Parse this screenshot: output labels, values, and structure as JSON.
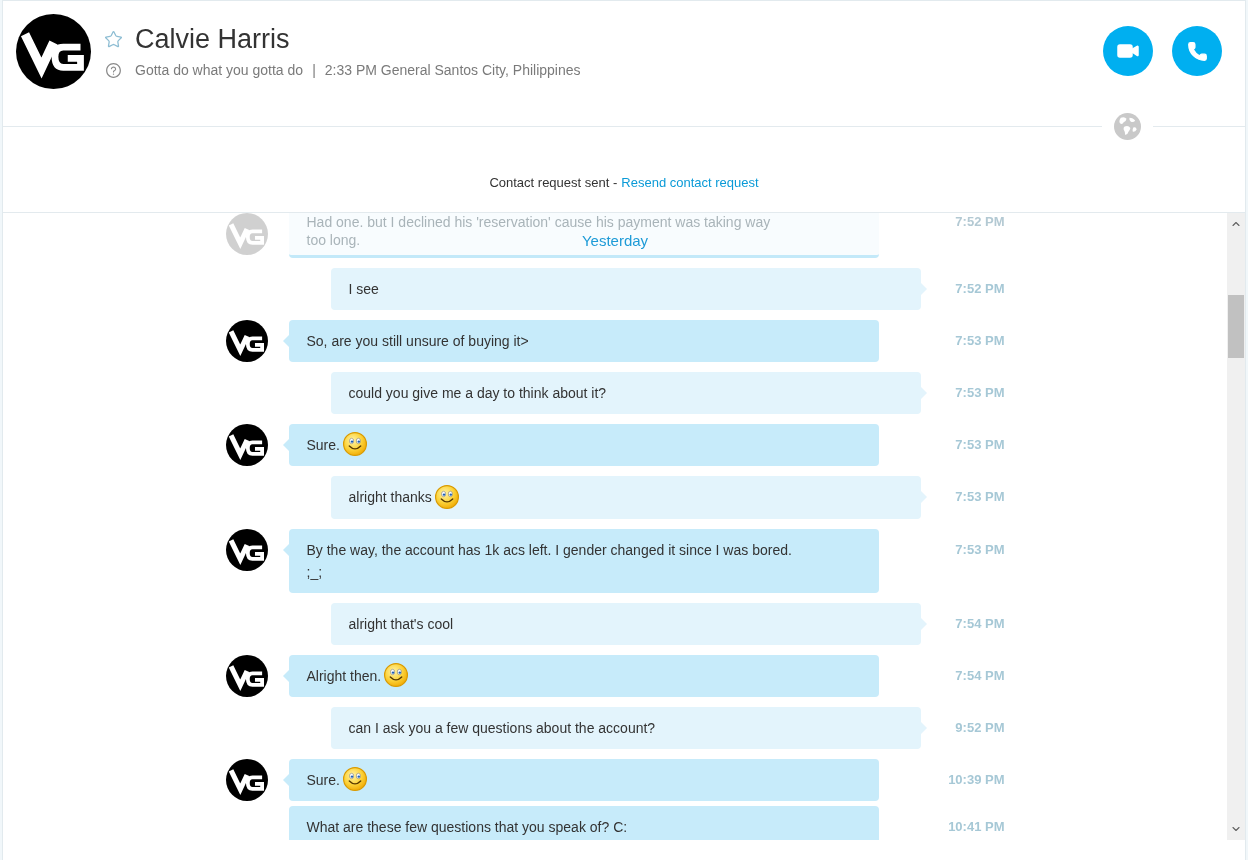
{
  "contact": {
    "name": "Calvie Harris",
    "favorite": false,
    "mood": "Gotta do what you gotta do",
    "separator": "|",
    "local_time_location": "2:33 PM General Santos City, Philippines"
  },
  "contact_request": {
    "status": "Contact request sent -",
    "link": "Resend contact request"
  },
  "date_label": "Yesterday",
  "messages": [
    {
      "kind": "incoming",
      "avatar": true,
      "faded": true,
      "emoticon": false,
      "text": "Had one. but I declined his 'reservation' cause his payment was taking way\ntoo long.",
      "time": "7:52 PM"
    },
    {
      "kind": "outgoing",
      "avatar": false,
      "faded": false,
      "emoticon": false,
      "text": "I see",
      "time": "7:52 PM"
    },
    {
      "kind": "incoming",
      "avatar": true,
      "faded": false,
      "emoticon": false,
      "text": "So, are you still unsure of buying it>",
      "time": "7:53 PM"
    },
    {
      "kind": "outgoing",
      "avatar": false,
      "faded": false,
      "emoticon": false,
      "text": "could you give me a day to think about it?",
      "time": "7:53 PM"
    },
    {
      "kind": "incoming",
      "avatar": true,
      "faded": false,
      "emoticon": true,
      "text": "Sure.",
      "time": "7:53 PM"
    },
    {
      "kind": "outgoing",
      "avatar": false,
      "faded": false,
      "emoticon": true,
      "text": "alright thanks",
      "time": "7:53 PM"
    },
    {
      "kind": "incoming",
      "avatar": true,
      "faded": false,
      "emoticon": false,
      "text": "By the way, the account has 1k acs left. I gender changed it since I was bored.\n;_;",
      "time": "7:53 PM"
    },
    {
      "kind": "outgoing",
      "avatar": false,
      "faded": false,
      "emoticon": false,
      "text": "alright that's cool",
      "time": "7:54 PM"
    },
    {
      "kind": "incoming",
      "avatar": true,
      "faded": false,
      "emoticon": true,
      "text": "Alright then.",
      "time": "7:54 PM"
    },
    {
      "kind": "outgoing",
      "avatar": false,
      "faded": false,
      "emoticon": false,
      "text": "can I ask you a few questions about the account?",
      "time": "9:52 PM"
    },
    {
      "kind": "incoming",
      "avatar": true,
      "faded": false,
      "emoticon": true,
      "text": "Sure.",
      "time": "10:39 PM"
    },
    {
      "kind": "incoming",
      "avatar": false,
      "faded": false,
      "emoticon": false,
      "text": "What are these few questions that you speak of? C:",
      "time": "10:41 PM"
    }
  ]
}
